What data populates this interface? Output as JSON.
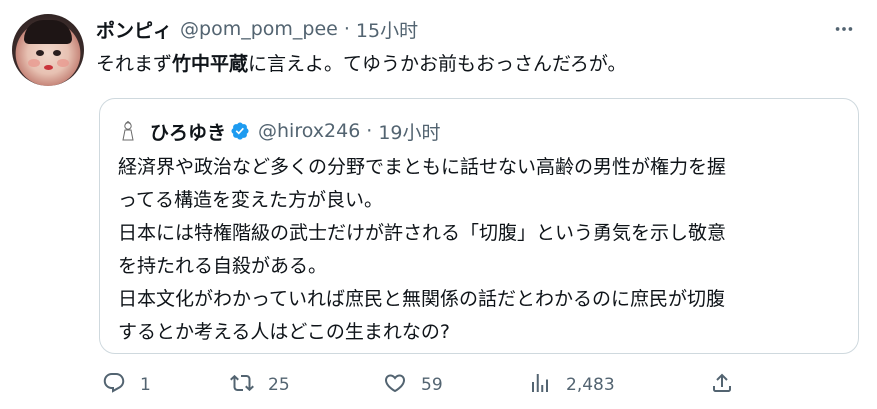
{
  "tweet": {
    "display_name": "ポンピィ",
    "handle": "@pom_pom_pee",
    "separator": "·",
    "time": "15小时",
    "text_before": "それまず",
    "text_bold": "竹中平蔵",
    "text_after": "に言えよ。てゆうかお前もおっさんだろが。"
  },
  "quote": {
    "display_name": "ひろゆき",
    "handle": "@hirox246",
    "separator": "·",
    "time": "19小时",
    "lines": [
      "経済界や政治など多くの分野でまともに話せない高齢の男性が権力を握",
      "ってる構造を変えた方が良い。",
      "日本には特権階級の武士だけが許される「切腹」という勇気を示し敬意",
      "を持たれる自殺がある。",
      "日本文化がわかっていれば庶民と無関係の話だとわかるのに庶民が切腹",
      "するとか考える人はどこの生まれなの?"
    ]
  },
  "actions": {
    "reply_count": "1",
    "retweet_count": "25",
    "like_count": "59",
    "view_count": "2,483"
  },
  "icons": {
    "more": "more-dots-icon",
    "verified": "verified-badge-icon",
    "reply": "reply-icon",
    "retweet": "retweet-icon",
    "like": "heart-icon",
    "views": "views-chart-icon",
    "share": "share-icon"
  },
  "colors": {
    "text": "#0f1419",
    "secondary": "#536471",
    "border": "#cfd9de",
    "verified": "#1d9bf0"
  }
}
